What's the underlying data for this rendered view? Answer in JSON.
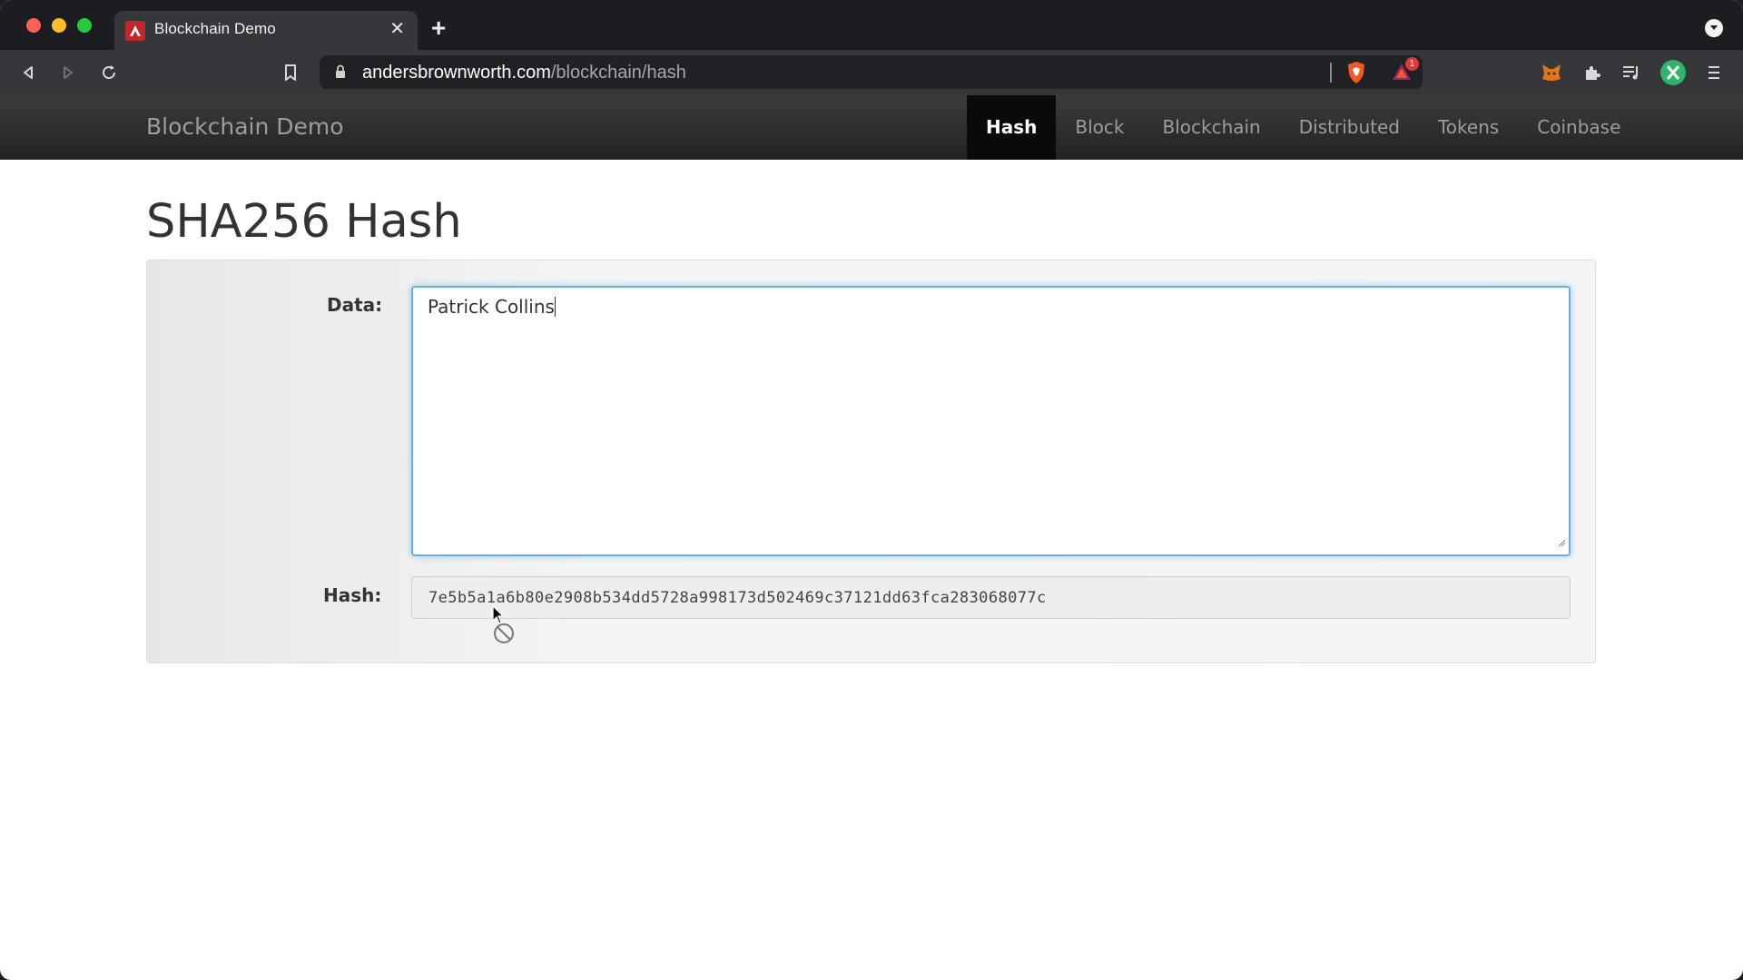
{
  "browser": {
    "tab_title": "Blockchain Demo",
    "url_domain": "andersbrownworth.com",
    "url_path": "/blockchain/hash",
    "rewards_badge": "1"
  },
  "site": {
    "brand": "Blockchain Demo",
    "nav": [
      {
        "label": "Hash",
        "active": true
      },
      {
        "label": "Block",
        "active": false
      },
      {
        "label": "Blockchain",
        "active": false
      },
      {
        "label": "Distributed",
        "active": false
      },
      {
        "label": "Tokens",
        "active": false
      },
      {
        "label": "Coinbase",
        "active": false
      }
    ]
  },
  "page": {
    "title": "SHA256 Hash",
    "data_label": "Data:",
    "data_value": "Patrick Collins",
    "hash_label": "Hash:",
    "hash_value": "7e5b5a1a6b80e2908b534dd5728a998173d502469c37121dd63fca283068077c"
  },
  "colors": {
    "focus_border": "#66afe9",
    "nav_active_bg": "#0a0a0a",
    "tab_favicon": "#c0262b"
  }
}
